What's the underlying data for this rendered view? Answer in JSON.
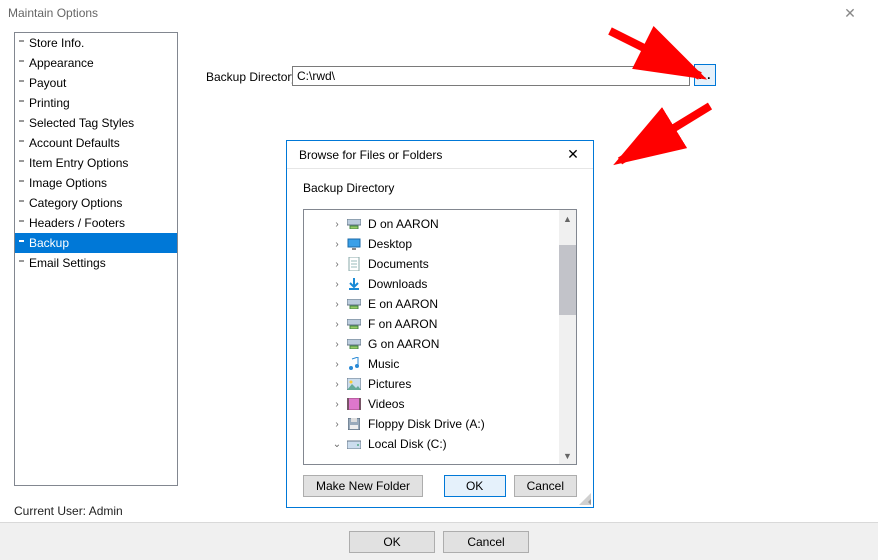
{
  "window": {
    "title": "Maintain Options"
  },
  "sidebar": {
    "items": [
      {
        "label": "Store Info."
      },
      {
        "label": "Appearance"
      },
      {
        "label": "Payout"
      },
      {
        "label": "Printing"
      },
      {
        "label": "Selected Tag Styles"
      },
      {
        "label": "Account Defaults"
      },
      {
        "label": "Item Entry Options"
      },
      {
        "label": "Image Options"
      },
      {
        "label": "Category Options"
      },
      {
        "label": "Headers / Footers"
      },
      {
        "label": "Backup"
      },
      {
        "label": "Email Settings"
      }
    ],
    "selected_index": 10
  },
  "status": {
    "current_user_label": "Current User: Admin"
  },
  "form": {
    "backup_dir_label": "Backup Directory",
    "backup_dir_value": "C:\\rwd\\",
    "browse_button": "..."
  },
  "dialog": {
    "title": "Browse for Files or Folders",
    "label": "Backup Directory",
    "tree": [
      {
        "label": "D on AARON",
        "icon": "net-drive",
        "expander": ">"
      },
      {
        "label": "Desktop",
        "icon": "desktop",
        "expander": ">"
      },
      {
        "label": "Documents",
        "icon": "document",
        "expander": ">"
      },
      {
        "label": "Downloads",
        "icon": "download",
        "expander": ">"
      },
      {
        "label": "E on AARON",
        "icon": "net-drive",
        "expander": ">"
      },
      {
        "label": "F on AARON",
        "icon": "net-drive",
        "expander": ">"
      },
      {
        "label": "G on AARON",
        "icon": "net-drive",
        "expander": ">"
      },
      {
        "label": "Music",
        "icon": "music",
        "expander": ">"
      },
      {
        "label": "Pictures",
        "icon": "pictures",
        "expander": ">"
      },
      {
        "label": "Videos",
        "icon": "videos",
        "expander": ">"
      },
      {
        "label": "Floppy Disk Drive (A:)",
        "icon": "floppy",
        "expander": ">"
      },
      {
        "label": "Local Disk (C:)",
        "icon": "disk",
        "expander": "v"
      }
    ],
    "buttons": {
      "new_folder": "Make New Folder",
      "ok": "OK",
      "cancel": "Cancel"
    }
  },
  "main_buttons": {
    "ok": "OK",
    "cancel": "Cancel"
  }
}
